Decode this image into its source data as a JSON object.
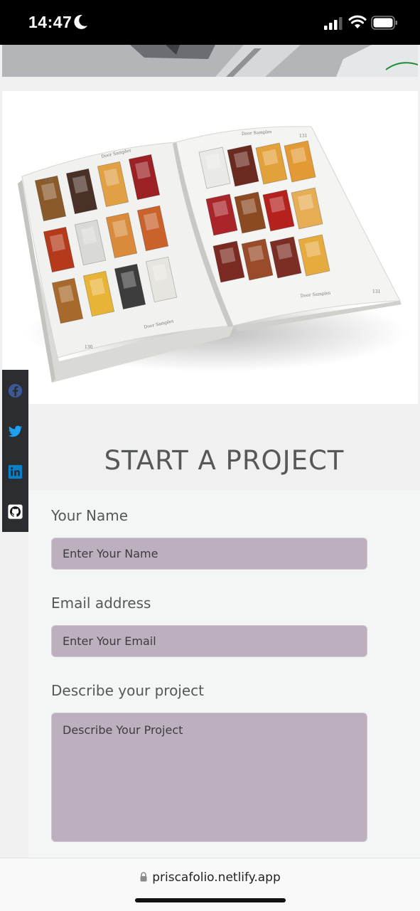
{
  "status_bar": {
    "time": "14:47",
    "icons": [
      "moon-icon",
      "cellular-signal-icon",
      "wifi-icon",
      "battery-icon"
    ]
  },
  "catalog_image": {
    "header_label": "Door Samples",
    "footer_label": "Door Samples",
    "page_numbers": [
      "130",
      "131"
    ],
    "door_colors": {
      "left_page": [
        "#8a5a2b",
        "#4a3128",
        "#e0a043",
        "#9b2124",
        "#b53a1c",
        "#d9d9d7",
        "#d98a3a",
        "#c9622b",
        "#a86a2c",
        "#e8b438",
        "#3d3d3d",
        "#e7e5e0"
      ],
      "right_page": [
        "#e9e9e7",
        "#6a2a20",
        "#e3a13c",
        "#e39a35",
        "#a9252a",
        "#8b4a22",
        "#b5221e",
        "#e6ad55",
        "#7a2a20",
        "#9a4c2a",
        "#7c2e24",
        "#e6ab3f"
      ]
    }
  },
  "social": {
    "items": [
      {
        "name": "facebook",
        "icon": "facebook-icon",
        "color": "#3b5998"
      },
      {
        "name": "twitter",
        "icon": "twitter-icon",
        "color": "#1da1f2"
      },
      {
        "name": "linkedin",
        "icon": "linkedin-icon",
        "color": "#0a80c6"
      },
      {
        "name": "github",
        "icon": "github-icon",
        "color": "#ffffff"
      }
    ]
  },
  "project": {
    "title": "START A PROJECT"
  },
  "form": {
    "name_label": "Your Name",
    "name_placeholder": "Enter Your Name",
    "email_label": "Email address",
    "email_placeholder": "Enter Your Email",
    "description_label": "Describe your project",
    "description_placeholder": "Describe Your Project",
    "input_color": "#bcb0bf"
  },
  "browser": {
    "url": "priscafolio.netlify.app",
    "lock_icon": "lock-icon"
  }
}
